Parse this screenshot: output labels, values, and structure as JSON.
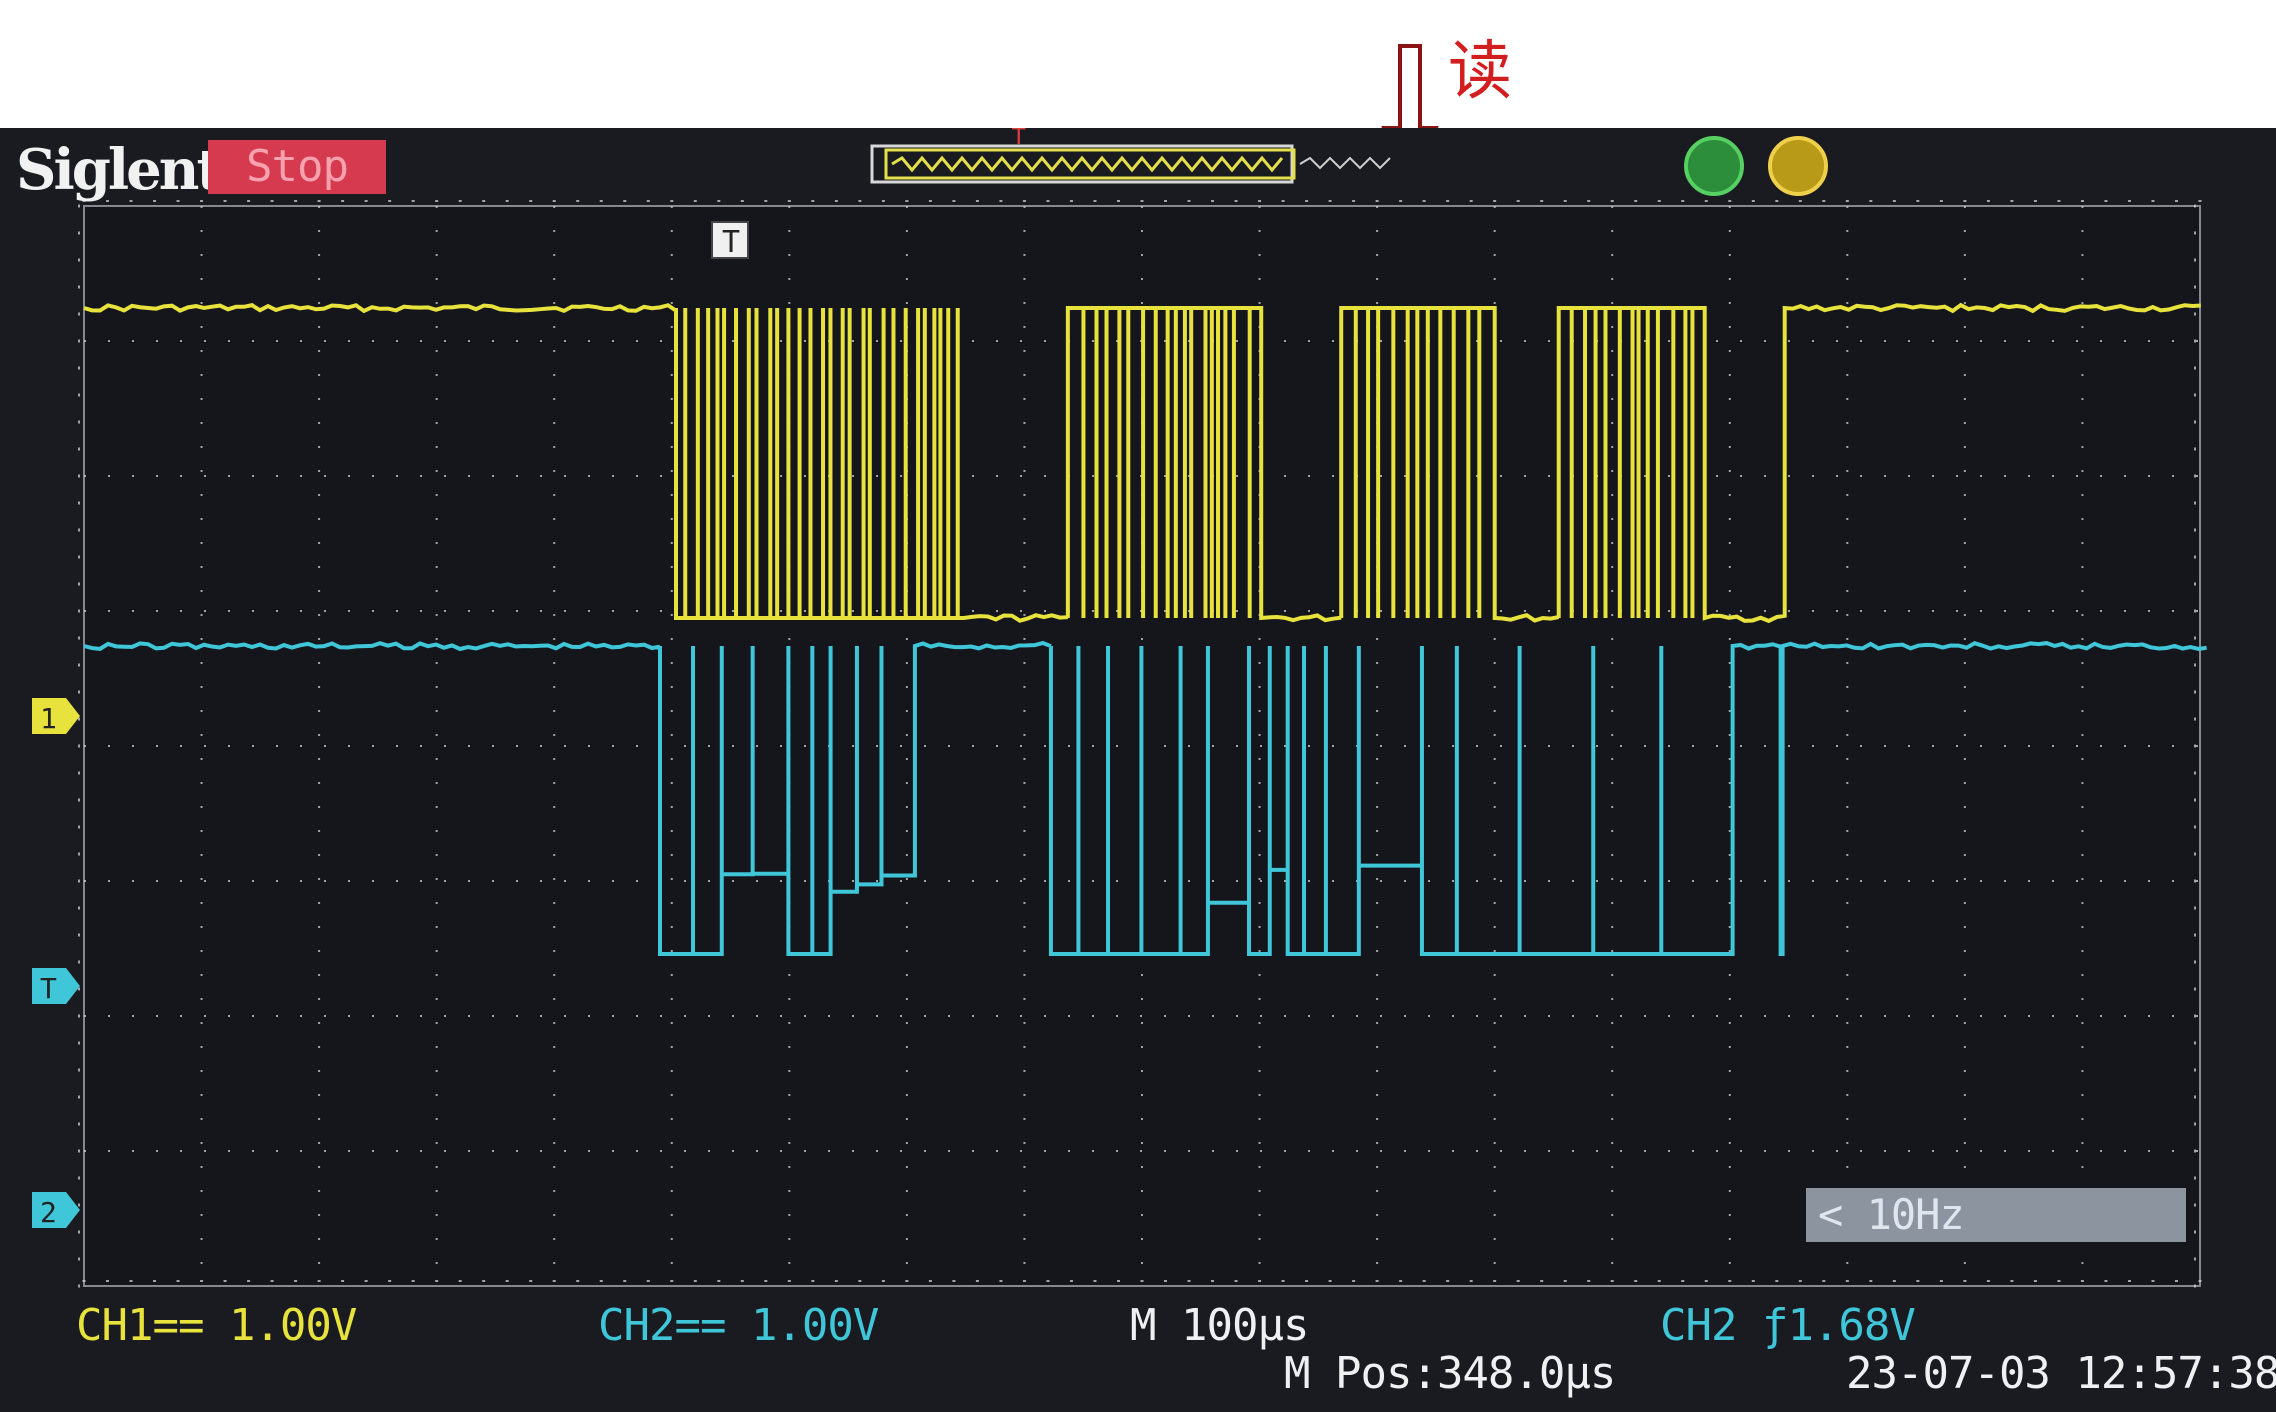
{
  "annotation": {
    "label": "读",
    "color": "#d21e1e"
  },
  "scope": {
    "brand": "Siglent",
    "run_state": "Stop",
    "trigger_marker": "T",
    "channel_markers": {
      "ch1": "1",
      "ch2": "2",
      "trigger_level": "T"
    },
    "frequency": "< 10Hz",
    "status_bar": {
      "ch1": "CH1== 1.00V",
      "ch2": "CH2== 1.00V",
      "timebase": "M 100μs",
      "trigger": "CH2 ƒ1.68V",
      "position": "M Pos:348.0μs",
      "datetime": "23-07-03 12:57:38"
    },
    "colors": {
      "ch1": "#e8e23d",
      "ch2": "#3fc6d8",
      "grid": "#cfd3d8",
      "screen_bg": "#15161c"
    }
  }
}
